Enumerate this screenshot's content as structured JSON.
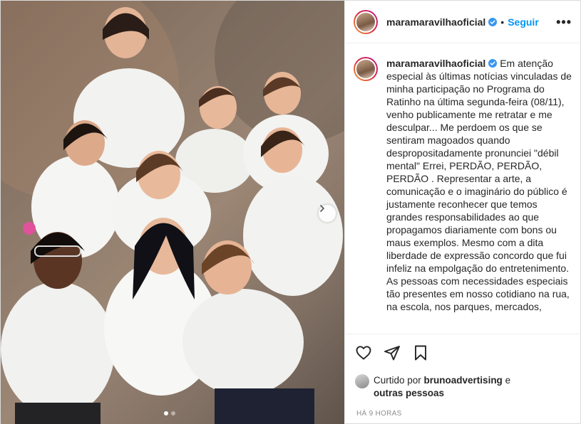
{
  "post": {
    "username": "maramaravilhaoficial",
    "separator": "•",
    "follow_label": "Seguir",
    "more_label": "•••"
  },
  "caption": {
    "username": "maramaravilhaoficial",
    "paragraphs": [
      "Em atenção especial às últimas notícias vinculadas de minha participação no Programa do Ratinho na última segunda-feira (08/11), venho publicamente me retratar e me desculpar... Me perdoem os que se sentiram magoados quando despropositadamente pronunciei \"débil mental\" Errei, PERDÃO, PERDÃO, PERDÃO . Representar a arte, a comunicação e o imaginário do público é justamente reconhecer que temos grandes responsabilidades ao que propagamos diariamente com bons ou maus exemplos. Mesmo com a dita liberdade de expressão concordo que fui infeliz na empolgação do entretenimento.",
      "As pessoas com necessidades especiais tão presentes em nosso cotidiano na rua, na escola, nos parques, mercados,"
    ]
  },
  "likes": {
    "prefix": "Curtido por ",
    "user": "brunoadvertising",
    "connector": " e",
    "others": "outras pessoas"
  },
  "timestamp": "HÁ 9 HORAS",
  "carousel": {
    "slide_count": 2,
    "active_slide": 1
  },
  "icons": {
    "verified": "verified-badge-icon",
    "like": "heart-icon",
    "share": "paper-plane-icon",
    "save": "bookmark-icon",
    "next": "chevron-right-icon"
  },
  "colors": {
    "link": "#0095f6",
    "verified": "#3897f0",
    "text": "#262626",
    "muted": "#8e8e8e"
  }
}
